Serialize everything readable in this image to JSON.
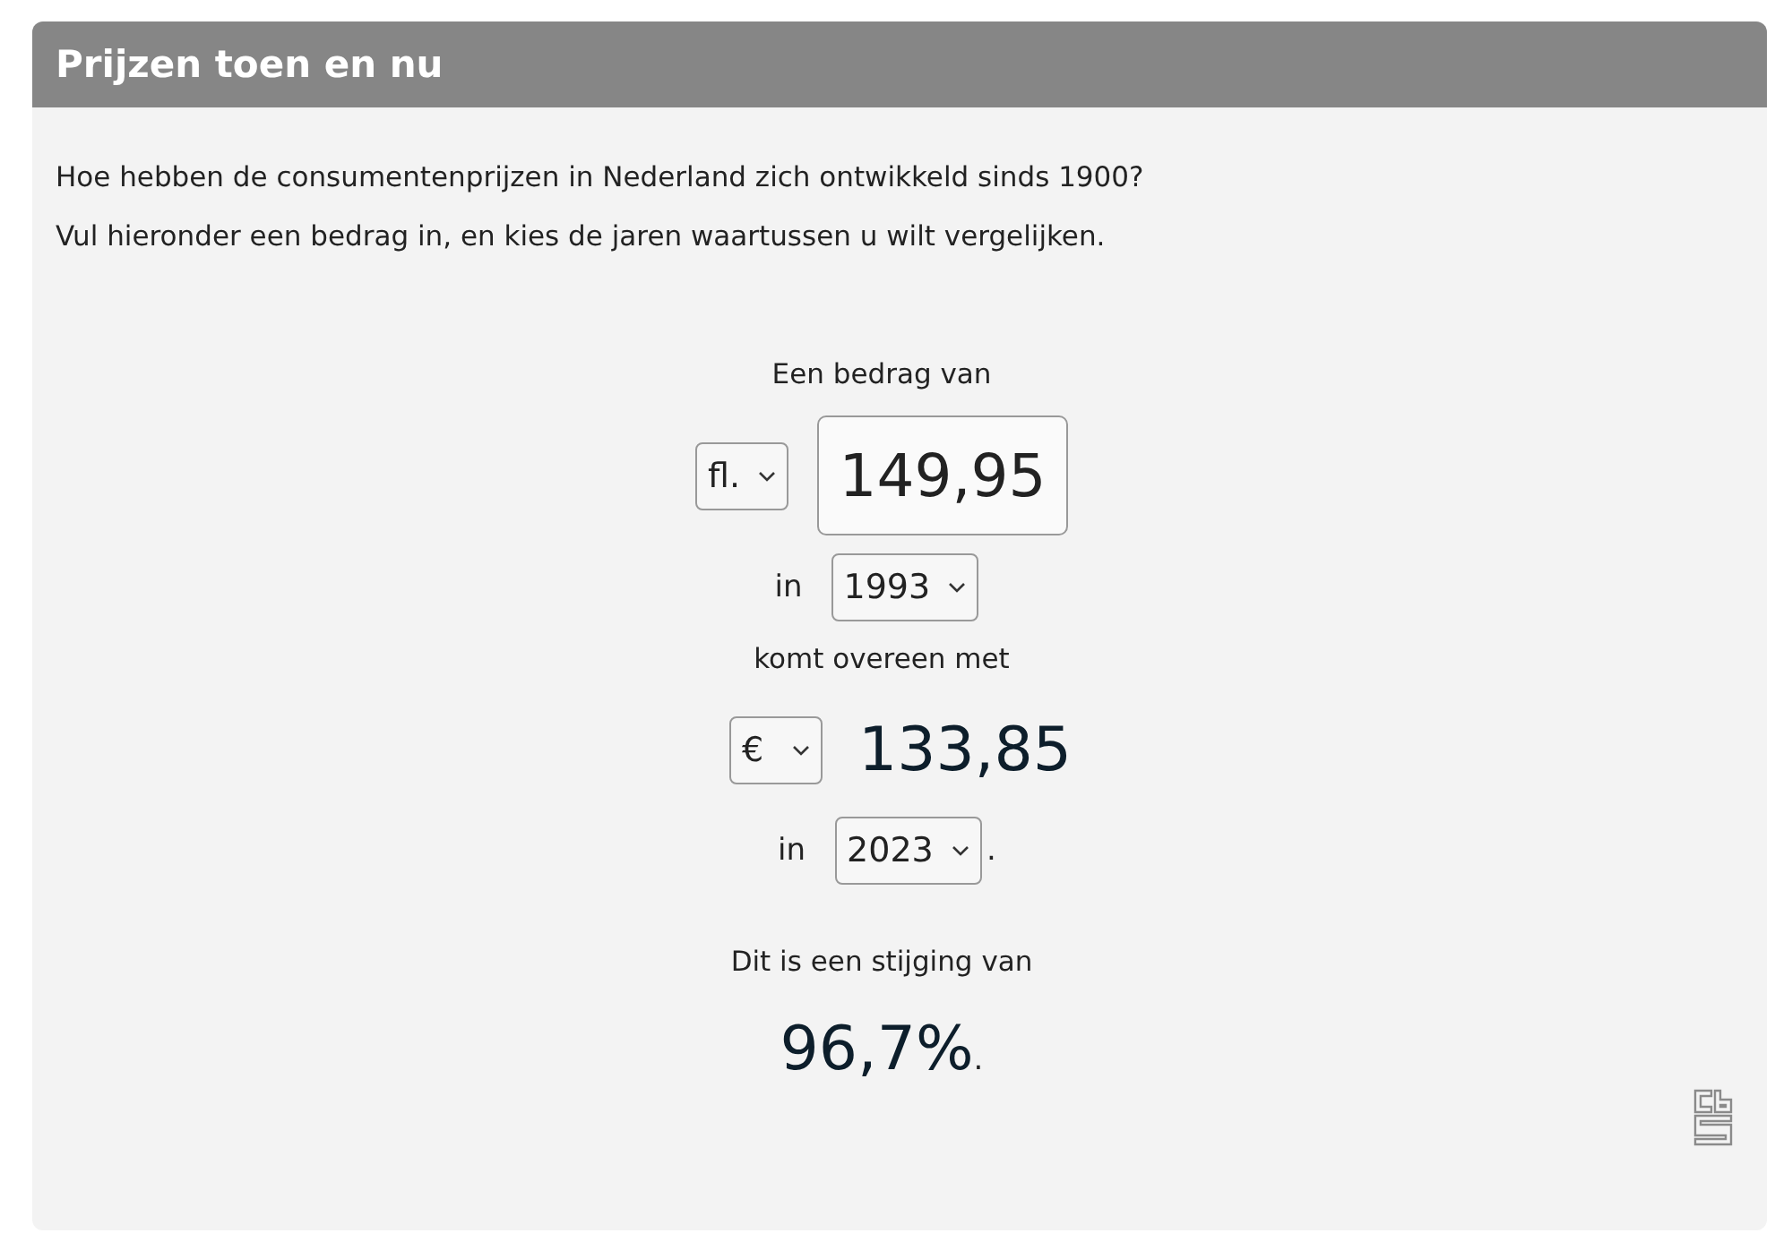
{
  "header": {
    "title": "Prijzen toen en nu"
  },
  "intro": [
    "Hoe hebben de consumentenprijzen in Nederland zich ontwikkeld sinds 1900?",
    "Vul hieronder een bedrag in, en kies de jaren waartussen u wilt vergelijken."
  ],
  "amount_label": "Een bedrag van",
  "from_currency": "fl.",
  "amount": "149,95",
  "from_year_label": "in",
  "from_year": "1993",
  "equals_label": "komt overeen met",
  "to_currency": "€",
  "result_amount": "133,85",
  "to_year_label": "in",
  "to_year": "2023",
  "to_year_end": ".",
  "increase_label": "Dit is een stijging van",
  "increase": "96,7%",
  "increase_end": "."
}
